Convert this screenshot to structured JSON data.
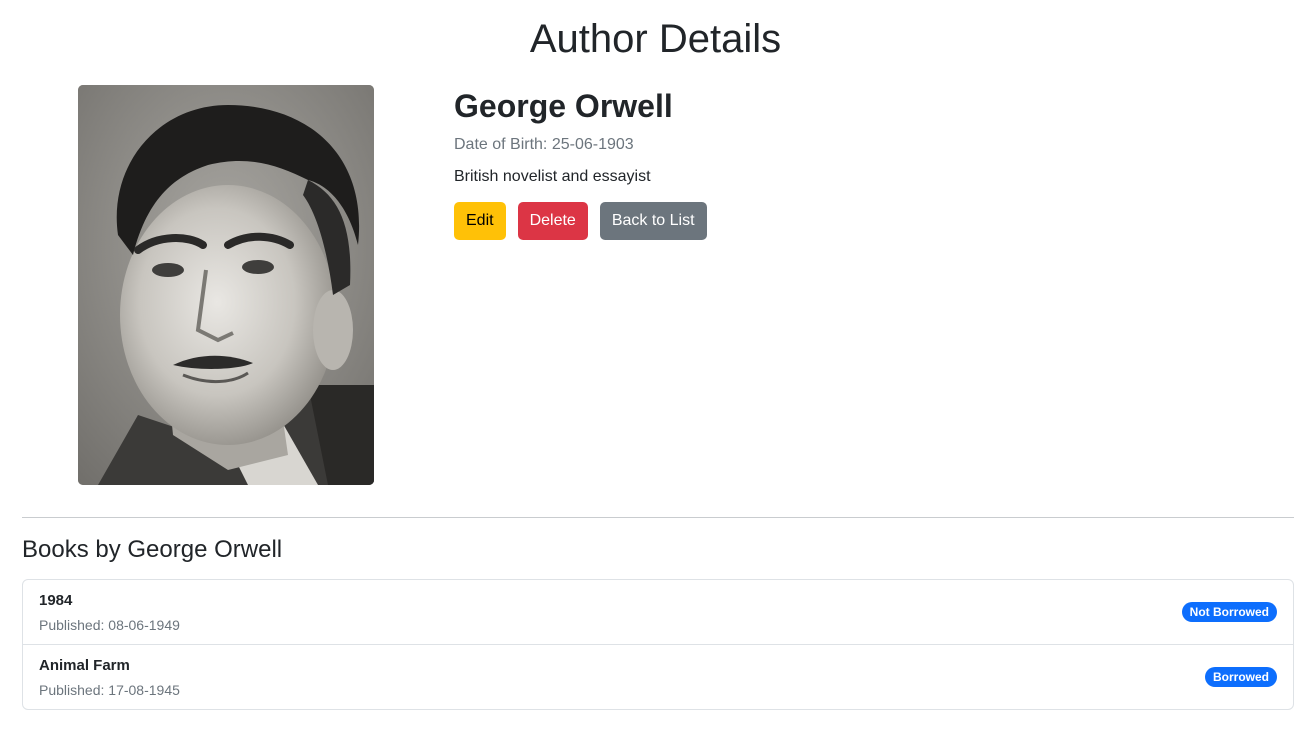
{
  "page": {
    "title": "Author Details"
  },
  "author": {
    "photo_icon": "author-portrait-photo",
    "name": "George Orwell",
    "dob_label": "Date of Birth:",
    "dob_value": "25-06-1903",
    "bio": "British novelist and essayist"
  },
  "actions": {
    "edit_label": "Edit",
    "delete_label": "Delete",
    "back_label": "Back to List"
  },
  "books": {
    "heading": "Books by George Orwell",
    "published_label": "Published:",
    "items": [
      {
        "title": "1984",
        "published": "08-06-1949",
        "status": "Not Borrowed"
      },
      {
        "title": "Animal Farm",
        "published": "17-08-1945",
        "status": "Borrowed"
      }
    ]
  },
  "colors": {
    "edit": "#ffc107",
    "delete": "#dc3545",
    "back": "#6c757d",
    "badge": "#0d6efd"
  }
}
